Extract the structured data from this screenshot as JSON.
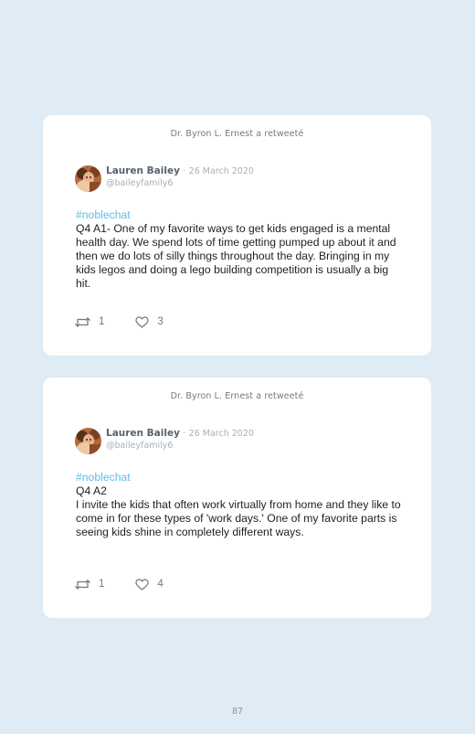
{
  "colors": {
    "page_background": "#dfecf5",
    "card_background": "#ffffff",
    "hashtag": "#5cbde6",
    "muted_text": "#a7b0b8"
  },
  "tweets": [
    {
      "retweeted_by": "Dr. Byron L. Ernest a retweeté",
      "author": {
        "name": "Lauren Bailey",
        "separator": "·",
        "date": "26 March 2020",
        "handle": "@baileyfamily6",
        "avatar_icon": "avatar-photo"
      },
      "hashtag": "#noblechat",
      "lines": [
        "Q4 A1- One of my favorite ways to get kids engaged is a mental health day. We spend lots of time getting pumped up about it and then we do lots of silly things throughout the day. Bringing in my kids legos and doing a lego building competition is usually a big hit."
      ],
      "retweet_icon": "retweet-icon",
      "retweets": "1",
      "like_icon": "heart-icon",
      "likes": "3"
    },
    {
      "retweeted_by": "Dr. Byron L. Ernest a retweeté",
      "author": {
        "name": "Lauren Bailey",
        "separator": "·",
        "date": "26 March 2020",
        "handle": "@baileyfamily6",
        "avatar_icon": "avatar-photo"
      },
      "hashtag": "#noblechat",
      "lines": [
        "Q4 A2",
        "I invite the kids that often work virtually from home and they like to come in for these types of 'work days.' One of my favorite parts is seeing kids shine in completely different ways."
      ],
      "retweet_icon": "retweet-icon",
      "retweets": "1",
      "like_icon": "heart-icon",
      "likes": "4"
    }
  ],
  "page_number": "87"
}
